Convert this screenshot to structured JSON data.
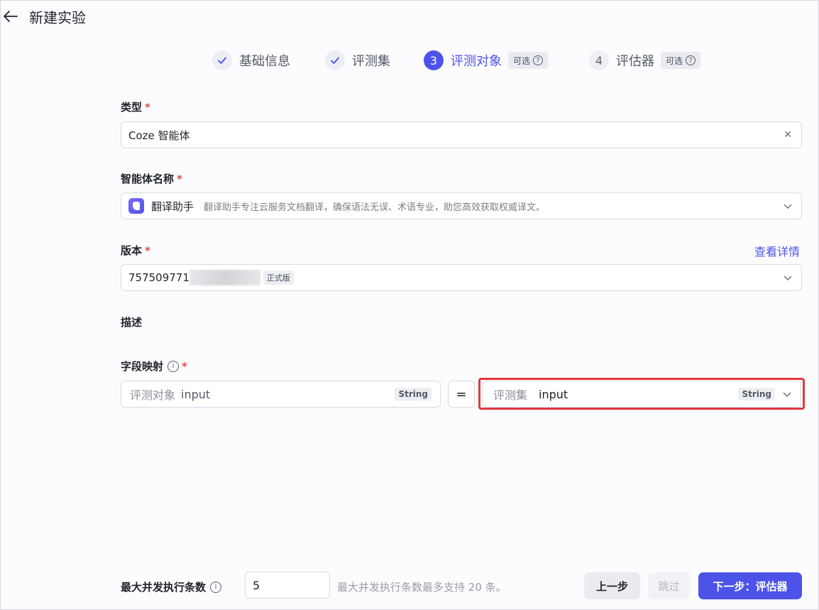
{
  "header": {
    "title": "新建实验"
  },
  "steps": [
    {
      "label": "基础信息",
      "state": "done"
    },
    {
      "label": "评测集",
      "state": "done"
    },
    {
      "number": "3",
      "label": "评测对象",
      "state": "active",
      "tag": "可选"
    },
    {
      "number": "4",
      "label": "评估器",
      "state": "todo",
      "tag": "可选"
    }
  ],
  "form": {
    "type": {
      "label": "类型",
      "value": "Coze 智能体"
    },
    "agent": {
      "label": "智能体名称",
      "name": "翻译助手",
      "description": "翻译助手专注云服务文档翻译，确保语法无误、术语专业，助您高效获取权威译文。"
    },
    "version": {
      "label": "版本",
      "value": "757509771",
      "tag": "正式版",
      "detail_link": "查看详情"
    },
    "description": {
      "label": "描述"
    },
    "mapping": {
      "label": "字段映射",
      "left_prefix": "评测对象",
      "left_field": "input",
      "left_type": "String",
      "equals": "=",
      "right_prefix": "评测集",
      "right_field": "input",
      "right_type": "String"
    }
  },
  "footer": {
    "concurrency_label": "最大并发执行条数",
    "concurrency_value": "5",
    "concurrency_hint": "最大并发执行条数最多支持 20 条。",
    "prev_label": "上一步",
    "skip_label": "跳过",
    "next_label": "下一步：评估器"
  },
  "colors": {
    "accent": "#4d53e8",
    "required": "#e5484d",
    "highlight_border": "#e0393e"
  }
}
